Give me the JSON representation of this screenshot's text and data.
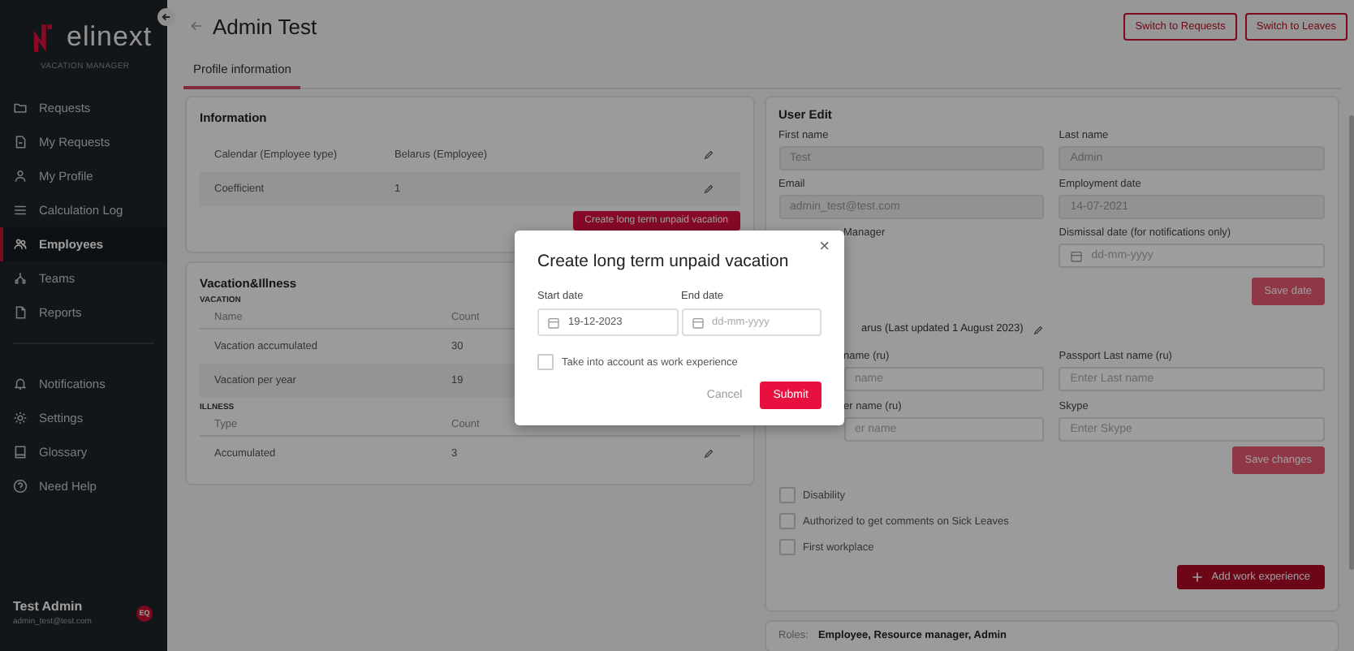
{
  "sidebar": {
    "logo": "elinext",
    "subtitle": "VACATION MANAGER",
    "items": [
      {
        "label": "Requests",
        "selected": false
      },
      {
        "label": "My Requests",
        "selected": false
      },
      {
        "label": "My Profile",
        "selected": false
      },
      {
        "label": "Calculation Log",
        "selected": false
      },
      {
        "label": "Employees",
        "selected": true
      },
      {
        "label": "Teams",
        "selected": false
      },
      {
        "label": "Reports",
        "selected": false
      }
    ],
    "bottom_items": [
      {
        "label": "Notifications",
        "selected": false
      },
      {
        "label": "Settings",
        "selected": false
      },
      {
        "label": "Glossary",
        "selected": false
      },
      {
        "label": "Need Help",
        "selected": false
      }
    ],
    "user": {
      "name": "Test Admin",
      "email": "admin_test@test.com",
      "badge": "EQ"
    }
  },
  "header": {
    "title": "Admin Test",
    "buttons": [
      "Switch to Requests",
      "Switch to Leaves"
    ]
  },
  "tabs": [
    {
      "label": "Profile information",
      "selected": true
    }
  ],
  "information": {
    "title": "Information",
    "rows": [
      {
        "label": "Calendar (Employee type)",
        "value": "Belarus (Employee)"
      },
      {
        "label": "Coefficient",
        "value": "1"
      }
    ],
    "action": "Create long term unpaid vacation"
  },
  "vacation_illness": {
    "title": "Vacation&Illness",
    "sections": [
      {
        "heading": "VACATION",
        "columns": [
          "Name",
          "Count"
        ],
        "rows": [
          {
            "name": "Vacation accumulated",
            "count": "30"
          },
          {
            "name": "Vacation per year",
            "count": "19"
          }
        ]
      },
      {
        "heading": "ILLNESS",
        "columns": [
          "Type",
          "Count"
        ],
        "rows": [
          {
            "name": "Accumulated",
            "count": "3"
          }
        ]
      }
    ]
  },
  "user_edit": {
    "title": "User Edit",
    "fields": [
      {
        "label": "First name",
        "value": "Test",
        "disabled": true
      },
      {
        "label": "Last name",
        "value": "Admin",
        "disabled": true
      },
      {
        "label": "Email",
        "value": "admin_test@test.com",
        "disabled": true
      },
      {
        "label": "Employment date",
        "value": "14-07-2021",
        "disabled": true
      },
      {
        "label": "Manager"
      },
      {
        "label": "Dismissal date (for notifications only)",
        "placeholder": "dd-mm-yyyy",
        "kind": "date",
        "disabled": false
      }
    ],
    "save_date": "Save date",
    "passport": {
      "title": "arus (Last updated 1 August 2023)",
      "fields": [
        {
          "label": "name (ru)",
          "placeholder": "name"
        },
        {
          "label": "Passport Last name (ru)",
          "placeholder": "Enter Last name"
        },
        {
          "label": "er name (ru)",
          "placeholder": "er name"
        },
        {
          "label": "Skype",
          "placeholder": "Enter Skype"
        }
      ]
    },
    "save_changes": "Save changes",
    "checkboxes": [
      {
        "label": "Disability",
        "checked": false
      },
      {
        "label": "Authorized to get comments on Sick Leaves",
        "checked": false
      },
      {
        "label": "First workplace",
        "checked": false
      }
    ],
    "add_button": "Add work experience"
  },
  "roles": {
    "label": "Roles:",
    "value": "Employee, Resource manager, Admin"
  },
  "modal": {
    "title": "Create long term unpaid vacation",
    "close": "×",
    "fields": [
      {
        "label": "Start date",
        "value": "19-12-2023"
      },
      {
        "label": "End date",
        "placeholder": "dd-mm-yyyy"
      }
    ],
    "checkbox": {
      "label": "Take into account as work experience",
      "checked": false
    },
    "buttons": [
      {
        "label": "Cancel",
        "kind": "secondary"
      },
      {
        "label": "Submit",
        "kind": "primary"
      }
    ]
  }
}
